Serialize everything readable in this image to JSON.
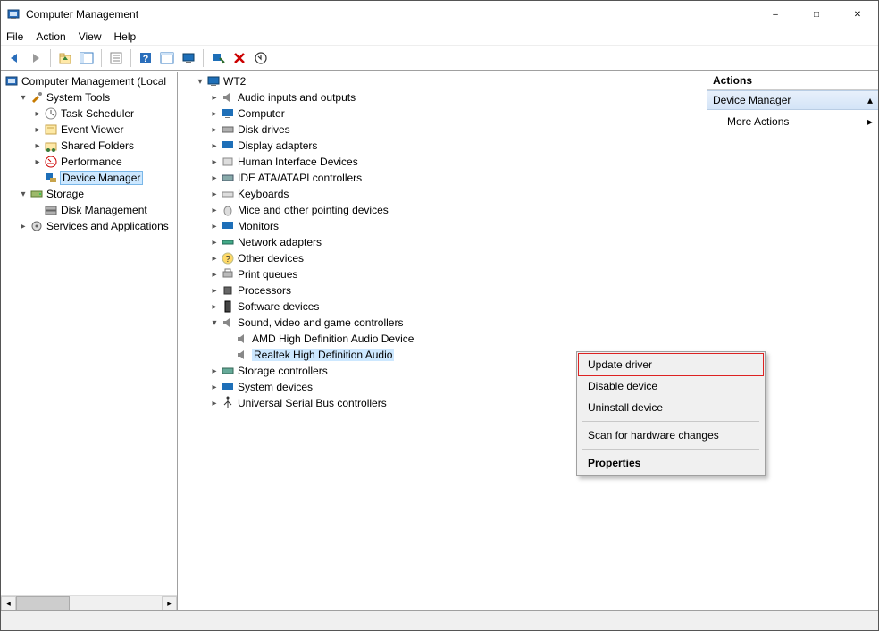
{
  "window": {
    "title": "Computer Management"
  },
  "menu": {
    "file": "File",
    "action": "Action",
    "view": "View",
    "help": "Help"
  },
  "left_tree": {
    "root": "Computer Management (Local",
    "system_tools": "System Tools",
    "task_scheduler": "Task Scheduler",
    "event_viewer": "Event Viewer",
    "shared_folders": "Shared Folders",
    "performance": "Performance",
    "device_manager": "Device Manager",
    "storage": "Storage",
    "disk_management": "Disk Management",
    "services_apps": "Services and Applications"
  },
  "device_tree": {
    "root": "WT2",
    "audio": "Audio inputs and outputs",
    "computer": "Computer",
    "disk_drives": "Disk drives",
    "display_adapters": "Display adapters",
    "hid": "Human Interface Devices",
    "ide": "IDE ATA/ATAPI controllers",
    "keyboards": "Keyboards",
    "mice": "Mice and other pointing devices",
    "monitors": "Monitors",
    "network": "Network adapters",
    "other": "Other devices",
    "print_queues": "Print queues",
    "processors": "Processors",
    "software": "Software devices",
    "sound": "Sound, video and game controllers",
    "sound_amd": "AMD High Definition Audio Device",
    "sound_realtek": "Realtek High Definition Audio",
    "storage_ctrl": "Storage controllers",
    "system_devices": "System devices",
    "usb": "Universal Serial Bus controllers"
  },
  "context": {
    "update": "Update driver",
    "disable": "Disable device",
    "uninstall": "Uninstall device",
    "scan": "Scan for hardware changes",
    "properties": "Properties"
  },
  "actions": {
    "header": "Actions",
    "group": "Device Manager",
    "more": "More Actions"
  }
}
